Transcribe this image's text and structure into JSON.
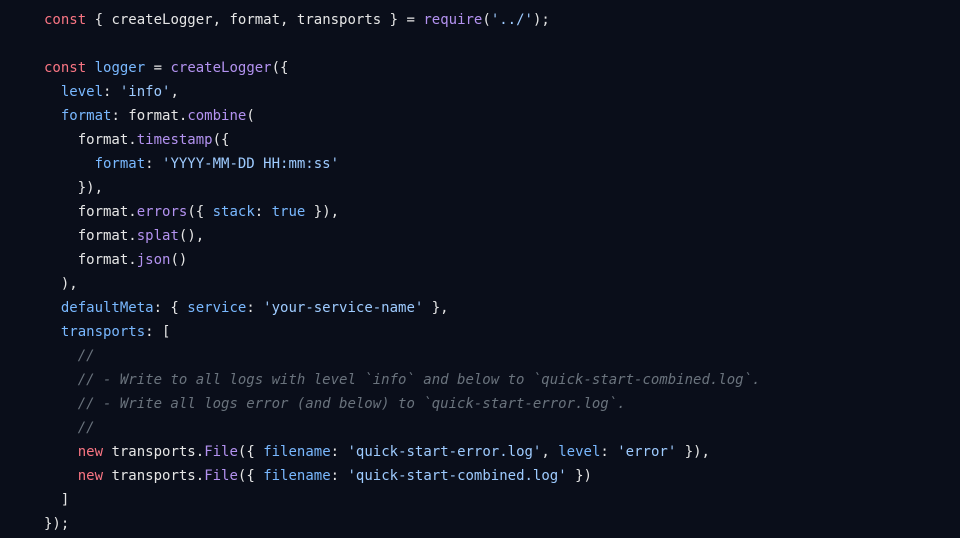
{
  "code": {
    "l1": {
      "const": "const",
      "destruct_open": " { ",
      "createLogger": "createLogger",
      "comma1": ", ",
      "format": "format",
      "comma2": ", ",
      "transports": "transports",
      "destruct_close": " } = ",
      "require": "require",
      "paren_open": "(",
      "path": "'../'",
      "paren_close": ");"
    },
    "l3": {
      "const": "const",
      "sp": " ",
      "logger": "logger",
      "eq": " = ",
      "createLogger": "createLogger",
      "open": "({"
    },
    "l4": {
      "indent": "  ",
      "level": "level",
      "colon": ": ",
      "value": "'info'",
      "comma": ","
    },
    "l5": {
      "indent": "  ",
      "format": "format",
      "colon": ": ",
      "ns": "format",
      "dot": ".",
      "combine": "combine",
      "open": "("
    },
    "l6": {
      "indent": "    ",
      "ns": "format",
      "dot": ".",
      "timestamp": "timestamp",
      "open": "({"
    },
    "l7": {
      "indent": "      ",
      "format": "format",
      "colon": ": ",
      "value": "'YYYY-MM-DD HH:mm:ss'"
    },
    "l8": {
      "indent": "    ",
      "close": "}),"
    },
    "l9": {
      "indent": "    ",
      "ns": "format",
      "dot": ".",
      "errors": "errors",
      "open": "({ ",
      "stack": "stack",
      "colon": ": ",
      "true": "true",
      "close": " }),"
    },
    "l10": {
      "indent": "    ",
      "ns": "format",
      "dot": ".",
      "splat": "splat",
      "parens": "(),"
    },
    "l11": {
      "indent": "    ",
      "ns": "format",
      "dot": ".",
      "json": "json",
      "parens": "()"
    },
    "l12": {
      "indent": "  ",
      "close": "),"
    },
    "l13": {
      "indent": "  ",
      "defaultMeta": "defaultMeta",
      "colon": ": { ",
      "service": "service",
      "colon2": ": ",
      "value": "'your-service-name'",
      "close": " },"
    },
    "l14": {
      "indent": "  ",
      "transports": "transports",
      "colon": ": ["
    },
    "l15": {
      "indent": "    ",
      "c": "//"
    },
    "l16": {
      "indent": "    ",
      "c": "// - Write to all logs with level `info` and below to `quick-start-combined.log`."
    },
    "l17": {
      "indent": "    ",
      "c": "// - Write all logs error (and below) to `quick-start-error.log`."
    },
    "l18": {
      "indent": "    ",
      "c": "//"
    },
    "l19": {
      "indent": "    ",
      "new": "new",
      "sp": " ",
      "transports": "transports",
      "dot": ".",
      "File": "File",
      "open": "({ ",
      "filename": "filename",
      "colon1": ": ",
      "fv": "'quick-start-error.log'",
      "comma": ", ",
      "level": "level",
      "colon2": ": ",
      "lv": "'error'",
      "close": " }),"
    },
    "l20": {
      "indent": "    ",
      "new": "new",
      "sp": " ",
      "transports": "transports",
      "dot": ".",
      "File": "File",
      "open": "({ ",
      "filename": "filename",
      "colon1": ": ",
      "fv": "'quick-start-combined.log'",
      "close": " })"
    },
    "l21": {
      "indent": "  ",
      "close": "]"
    },
    "l22": {
      "close": "});"
    }
  }
}
